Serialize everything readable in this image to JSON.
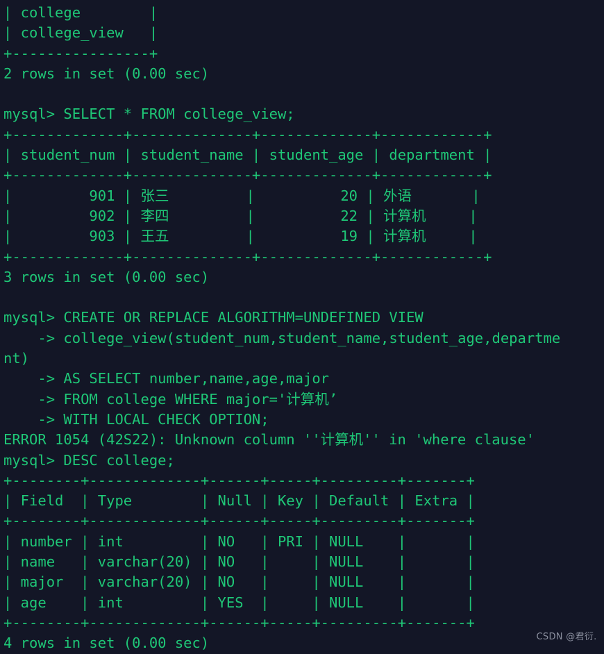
{
  "terminal": {
    "title": "MySQL command line client",
    "background_color": "#131626",
    "text_color": "#1fc777",
    "watermark_color": "#8a8f9e",
    "prompt": "mysql>",
    "continuation_prompt": "->",
    "font_size_px": 20.5,
    "line_height_px": 29.3
  },
  "watermark": {
    "text": "CSDN @君衍. "
  },
  "lines": [
    "| college        |",
    "| college_view   |",
    "+----------------+",
    "2 rows in set (0.00 sec)",
    "",
    "mysql> SELECT * FROM college_view;",
    "+-------------+--------------+-------------+------------+",
    "| student_num | student_name | student_age | department |",
    "+-------------+--------------+-------------+------------+",
    "|         901 | 张三         |          20 | 外语       |",
    "|         902 | 李四         |          22 | 计算机     |",
    "|         903 | 王五         |          19 | 计算机     |",
    "+-------------+--------------+-------------+------------+",
    "3 rows in set (0.00 sec)",
    "",
    "mysql> CREATE OR REPLACE ALGORITHM=UNDEFINED VIEW",
    "    -> college_view(student_num,student_name,student_age,departme",
    "nt)",
    "    -> AS SELECT number,name,age,major",
    "    -> FROM college WHERE major='计算机’",
    "    -> WITH LOCAL CHECK OPTION;",
    "ERROR 1054 (42S22): Unknown column ''计算机'' in 'where clause'",
    "mysql> DESC college;",
    "+--------+-------------+------+-----+---------+-------+",
    "| Field  | Type        | Null | Key | Default | Extra |",
    "+--------+-------------+------+-----+---------+-------+",
    "| number | int         | NO   | PRI | NULL    |       |",
    "| name   | varchar(20) | NO   |     | NULL    |       |",
    "| major  | varchar(20) | NO   |     | NULL    |       |",
    "| age    | int         | YES  |     | NULL    |       |",
    "+--------+-------------+------+-----+---------+-------+",
    "4 rows in set (0.00 sec)"
  ],
  "session": {
    "statements": [
      {
        "prompt": "mysql>",
        "sql": "SELECT * FROM college_view;",
        "result_rows": 3,
        "result_time": "0.00 sec",
        "status": "3 rows in set (0.00 sec)"
      },
      {
        "prompt": "mysql>",
        "sql": "CREATE OR REPLACE ALGORITHM=UNDEFINED VIEW college_view(student_num,student_name,student_age,department) AS SELECT number,name,age,major FROM college WHERE major='计算机’ WITH LOCAL CHECK OPTION;",
        "status": "ERROR 1054 (42S22): Unknown column ''计算机'' in 'where clause'",
        "error_code": "1054",
        "sqlstate": "42S22"
      },
      {
        "prompt": "mysql>",
        "sql": "DESC college;",
        "result_rows": 4,
        "result_time": "0.00 sec",
        "status": "4 rows in set (0.00 sec)"
      }
    ]
  },
  "tables": {
    "show_tables_tail": {
      "values": [
        "college",
        "college_view"
      ],
      "status": "2 rows in set (0.00 sec)"
    },
    "college_view": {
      "columns": [
        "student_num",
        "student_name",
        "student_age",
        "department"
      ],
      "rows": [
        [
          "901",
          "张三",
          "20",
          "外语"
        ],
        [
          "902",
          "李四",
          "22",
          "计算机"
        ],
        [
          "903",
          "王五",
          "19",
          "计算机"
        ]
      ],
      "status": "3 rows in set (0.00 sec)"
    },
    "desc_college": {
      "columns": [
        "Field",
        "Type",
        "Null",
        "Key",
        "Default",
        "Extra"
      ],
      "rows": [
        [
          "number",
          "int",
          "NO",
          "PRI",
          "NULL",
          ""
        ],
        [
          "name",
          "varchar(20)",
          "NO",
          "",
          "NULL",
          ""
        ],
        [
          "major",
          "varchar(20)",
          "NO",
          "",
          "NULL",
          ""
        ],
        [
          "age",
          "int",
          "YES",
          "",
          "NULL",
          ""
        ]
      ],
      "status": "4 rows in set (0.00 sec)"
    }
  }
}
